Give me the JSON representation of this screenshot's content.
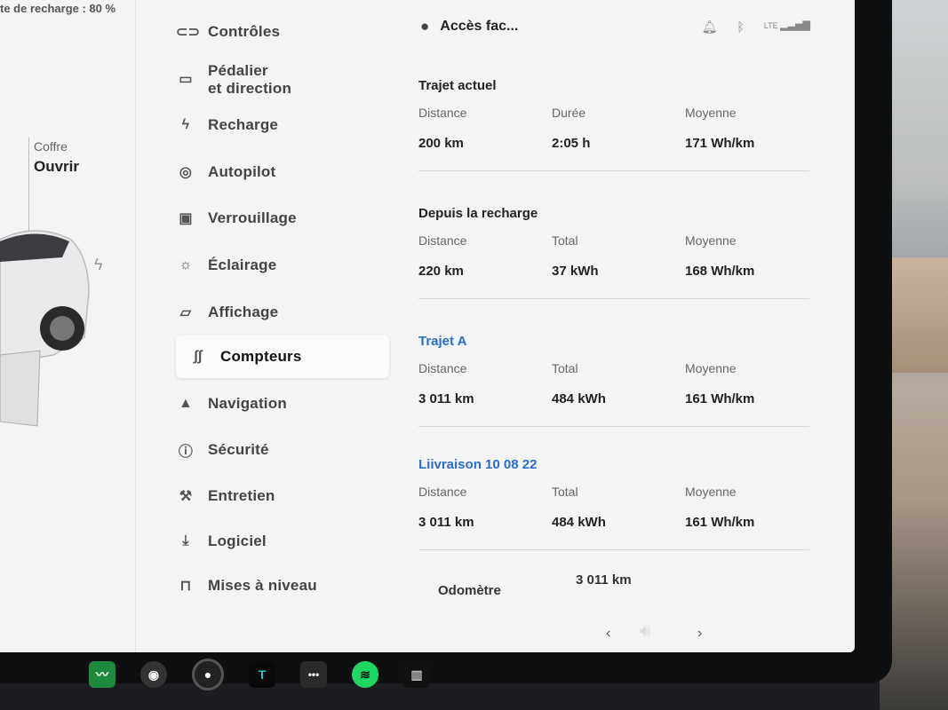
{
  "car_panel": {
    "charge_status": "te de recharge : 80 %",
    "coffre_label": "Coffre",
    "coffre_action": "Ouvrir"
  },
  "menu": {
    "items": [
      {
        "label": "Contrôles",
        "icon": "toggle-icon"
      },
      {
        "label": "Pédalier\net direction",
        "icon": "car-icon"
      },
      {
        "label": "Recharge",
        "icon": "bolt-icon"
      },
      {
        "label": "Autopilot",
        "icon": "steering-wheel-icon"
      },
      {
        "label": "Verrouillage",
        "icon": "lock-icon"
      },
      {
        "label": "Éclairage",
        "icon": "light-icon"
      },
      {
        "label": "Affichage",
        "icon": "display-icon"
      },
      {
        "label": "Compteurs",
        "icon": "trip-icon",
        "selected": true
      },
      {
        "label": "Navigation",
        "icon": "navigation-icon"
      },
      {
        "label": "Sécurité",
        "icon": "alert-icon"
      },
      {
        "label": "Entretien",
        "icon": "wrench-icon"
      },
      {
        "label": "Logiciel",
        "icon": "download-icon"
      },
      {
        "label": "Mises à niveau",
        "icon": "bag-icon"
      }
    ]
  },
  "topbar": {
    "user_label": "Accès fac...",
    "icons": [
      "bell-icon",
      "bluetooth-icon",
      "lte-signal-icon"
    ],
    "lte_text": "LTE"
  },
  "trips": [
    {
      "title": "Trajet actuel",
      "title_style": "dark",
      "columns": [
        {
          "label": "Distance",
          "value": "200  km"
        },
        {
          "label": "Durée",
          "value": "2:05  h"
        },
        {
          "label": "Moyenne",
          "value": "171  Wh/km"
        }
      ]
    },
    {
      "title": "Depuis la recharge",
      "title_style": "dark",
      "columns": [
        {
          "label": "Distance",
          "value": "220  km"
        },
        {
          "label": "Total",
          "value": "37  kWh"
        },
        {
          "label": "Moyenne",
          "value": "168  Wh/km"
        }
      ]
    },
    {
      "title": "Trajet A",
      "title_style": "blue",
      "columns": [
        {
          "label": "Distance",
          "value": "3 011  km"
        },
        {
          "label": "Total",
          "value": "484  kWh"
        },
        {
          "label": "Moyenne",
          "value": "161  Wh/km"
        }
      ]
    },
    {
      "title": "Liivraison 10 08 22",
      "title_style": "blue",
      "columns": [
        {
          "label": "Distance",
          "value": "3 011  km"
        },
        {
          "label": "Total",
          "value": "484  kWh"
        },
        {
          "label": "Moyenne",
          "value": "161  Wh/km"
        }
      ]
    }
  ],
  "odometer": {
    "label": "Odomètre",
    "value": "3 011  km"
  },
  "dock": {
    "apps": [
      "chart-app-icon",
      "camera-app-icon",
      "dashcam-app-icon",
      "toybox-app-icon",
      "more-apps-icon",
      "spotify-icon",
      "usb-icon"
    ],
    "toybox_text": "T",
    "more_text": "•••"
  },
  "colors": {
    "accent_blue": "#2a6dcc",
    "screen_bg": "#f3f4f5",
    "bezel": "#0e0f10"
  }
}
